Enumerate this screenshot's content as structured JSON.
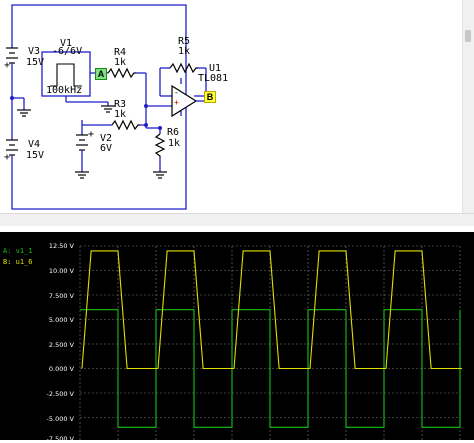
{
  "schematic": {
    "v3": {
      "name": "V3",
      "value": "15V"
    },
    "v1": {
      "name": "V1",
      "value": "-6/6V",
      "freq": "100kHz"
    },
    "v4": {
      "name": "V4",
      "value": "15V"
    },
    "v2": {
      "name": "V2",
      "value": "6V"
    },
    "r4": {
      "name": "R4",
      "value": "1k"
    },
    "r3": {
      "name": "R3",
      "value": "1k"
    },
    "r5": {
      "name": "R5",
      "value": "1k"
    },
    "r6": {
      "name": "R6",
      "value": "1k"
    },
    "u1": {
      "name": "U1",
      "model": "TL081"
    },
    "probe_a": "A",
    "probe_b": "B",
    "plus_sign": "+",
    "minus_sign": "-"
  },
  "scope": {
    "traces": [
      {
        "label": "A: v1_1",
        "color": "#18c018"
      },
      {
        "label": "B: u1_6",
        "color": "#e0e000"
      }
    ],
    "y_ticks": [
      "12.50 V",
      "10.00 V",
      "7.500 V",
      "5.000 V",
      "2.500 V",
      "0.000 V",
      "-2.500 V",
      "-5.000 V",
      "-7.500 V"
    ],
    "colors": {
      "background": "#000000",
      "grid": "#7a7a7a",
      "trace_a": "#18c018",
      "trace_b": "#e0e000"
    }
  },
  "chart_data": {
    "type": "line",
    "title": "",
    "xlabel": "",
    "ylabel": "",
    "ylim": [
      -7.5,
      12.5
    ],
    "grid": true,
    "legend": "top-left",
    "series": [
      {
        "name": "A: v1_1",
        "description_levels": [
          6,
          -6
        ],
        "values": [
          6,
          6,
          -6,
          -6,
          6,
          6,
          -6,
          -6,
          6,
          6,
          -6,
          -6,
          6,
          6,
          -6,
          -6,
          6,
          6,
          -6,
          -6
        ]
      },
      {
        "name": "B: u1_6",
        "values": [
          12,
          12,
          0,
          0,
          12,
          12,
          0,
          0,
          12,
          12,
          0,
          0,
          12,
          12,
          0,
          0,
          12,
          12,
          0,
          0
        ]
      }
    ]
  }
}
